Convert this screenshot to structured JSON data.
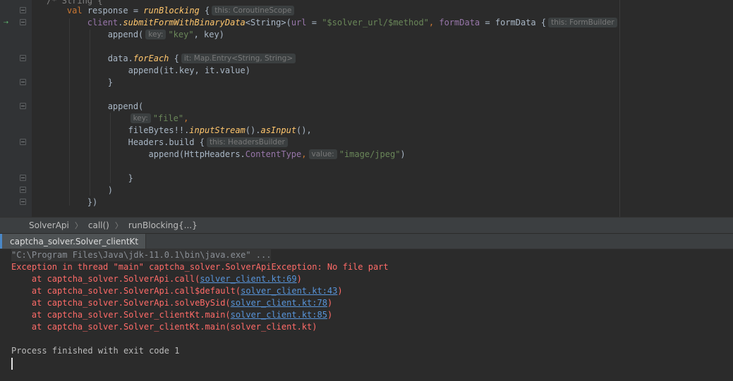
{
  "editor": {
    "lines": [
      {
        "indent": "",
        "text": "/* String {"
      },
      {
        "indent": "    ",
        "kw": "val",
        "text": " response = ",
        "fn": "runBlocking",
        "after": " {",
        "hint": "this: CoroutineScope"
      },
      {
        "indent": "        ",
        "prop": "client",
        "dot": ".",
        "fn": "submitFormWithBinaryData",
        "text": "<String>(",
        "name1": "url",
        "eq1": " = ",
        "str1": "\"$solver_url/$method\"",
        "comma": ", ",
        "name2": "formData",
        "eq2": " = ",
        "val2": "formData",
        "after": " {",
        "hint": "this: FormBuilder"
      },
      {
        "indent": "            ",
        "text": "append(",
        "hint": "key:",
        "str": "\"key\"",
        "after": ", key)"
      },
      {
        "indent": "",
        "text": ""
      },
      {
        "indent": "            ",
        "text": "data.",
        "fn": "forEach",
        "after": " {",
        "hint": "it: Map.Entry<String, String>"
      },
      {
        "indent": "                ",
        "text": "append(it.key, it.value)"
      },
      {
        "indent": "            ",
        "text": "}"
      },
      {
        "indent": "",
        "text": ""
      },
      {
        "indent": "            ",
        "text": "append("
      },
      {
        "indent": "                ",
        "hint": "key:",
        "str": "\"file\"",
        "after": ","
      },
      {
        "indent": "                ",
        "text": "fileBytes!!.",
        "fn": "inputStream",
        "mid": "().",
        "fn2": "asInput",
        "after": "(),"
      },
      {
        "indent": "                ",
        "text": "Headers.build {",
        "hint": "this: HeadersBuilder"
      },
      {
        "indent": "                    ",
        "text": "append(HttpHeaders.",
        "prop": "ContentType",
        "after": ",",
        "hint": "value:",
        "str": "\"image/jpeg\"",
        "tail": ")"
      },
      {
        "indent": "",
        "text": ""
      },
      {
        "indent": "                ",
        "text": "}"
      },
      {
        "indent": "            ",
        "text": ")"
      },
      {
        "indent": "        ",
        "text": "})"
      }
    ]
  },
  "breadcrumb": {
    "items": [
      "SolverApi",
      "call()",
      "runBlocking{...}"
    ],
    "separator": "〉"
  },
  "run_panel": {
    "tab_label": "captcha_solver.Solver_clientKt",
    "command": "\"C:\\Program Files\\Java\\jdk-11.0.1\\bin\\java.exe\" ...",
    "exception": "Exception in thread \"main\" captcha_solver.SolverApiException: No file part",
    "trace": [
      {
        "prefix": "    at captcha_solver.SolverApi.call(",
        "link": "solver_client.kt:69",
        "suffix": ")"
      },
      {
        "prefix": "    at captcha_solver.SolverApi.call$default(",
        "link": "solver_client.kt:43",
        "suffix": ")"
      },
      {
        "prefix": "    at captcha_solver.SolverApi.solveBySid(",
        "link": "solver_client.kt:78",
        "suffix": ")"
      },
      {
        "prefix": "    at captcha_solver.Solver_clientKt.main(",
        "link": "solver_client.kt:85",
        "suffix": ")"
      },
      {
        "prefix": "    at captcha_solver.Solver_clientKt.main(solver_client.kt)",
        "link": "",
        "suffix": ""
      }
    ],
    "exit_message": "Process finished with exit code 1"
  },
  "colors": {
    "editor_bg": "#2b2b2b",
    "gutter_bg": "#313335",
    "keyword": "#cc7832",
    "function": "#ffc66d",
    "property": "#9876aa",
    "string": "#6a8759",
    "error": "#ff6b68",
    "link": "#5894d9"
  }
}
